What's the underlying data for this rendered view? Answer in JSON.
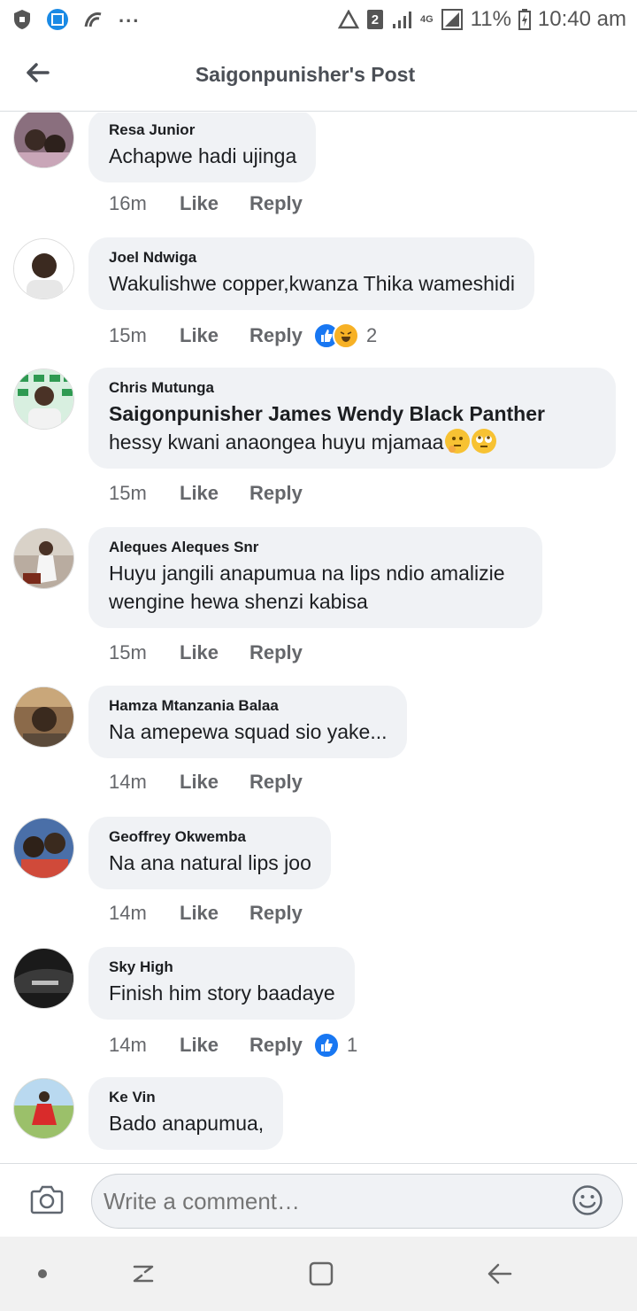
{
  "status_bar": {
    "sim_slot": "2",
    "network": "4G",
    "battery": "11%",
    "time": "10:40 am"
  },
  "header": {
    "title": "Saigonpunisher's Post"
  },
  "comments": [
    {
      "author": "Resa Junior",
      "text": "Achapwe hadi ujinga",
      "time": "16m",
      "like": "Like",
      "reply": "Reply"
    },
    {
      "author": "Joel Ndwiga",
      "text": "Wakulishwe copper,kwanza Thika wameshidi",
      "time": "15m",
      "like": "Like",
      "reply": "Reply",
      "reaction_count": "2"
    },
    {
      "author": "Chris Mutunga",
      "mention": "Saigonpunisher James Wendy Black Panther",
      "text": " hessy kwani anaongea huyu mjamaa",
      "time": "15m",
      "like": "Like",
      "reply": "Reply"
    },
    {
      "author": "Aleques Aleques Snr",
      "text": "Huyu jangili anapumua na lips ndio amalizie wengine hewa shenzi kabisa",
      "time": "15m",
      "like": "Like",
      "reply": "Reply"
    },
    {
      "author": "Hamza Mtanzania Balaa",
      "text": "Na amepewa squad sio yake...",
      "time": "14m",
      "like": "Like",
      "reply": "Reply"
    },
    {
      "author": "Geoffrey Okwemba",
      "text": "Na ana natural lips joo",
      "time": "14m",
      "like": "Like",
      "reply": "Reply"
    },
    {
      "author": "Sky High",
      "text": "Finish him story baadaye",
      "time": "14m",
      "like": "Like",
      "reply": "Reply",
      "reaction_count": "1"
    },
    {
      "author": "Ke Vin",
      "text": "Bado anapumua,"
    }
  ],
  "composer": {
    "placeholder": "Write a comment…"
  },
  "colors": {
    "facebook_blue": "#1877f2",
    "bubble_bg": "#f0f2f5",
    "muted_text": "#65676b"
  }
}
